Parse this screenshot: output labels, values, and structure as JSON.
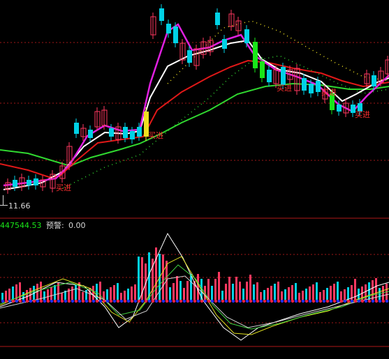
{
  "labels": {
    "price_low": "11.66",
    "indicator_value": "447544.53",
    "warn_label": "预警:",
    "warn_value": "0.00"
  },
  "signals": [
    "买进",
    "买进",
    "买进",
    "买进",
    "买进"
  ],
  "colors": {
    "up": "#ff3860",
    "down": "#00d2e6",
    "strong_down": "#19e619",
    "ma_fast": "#ffffff",
    "ma_purple": "#e020e0",
    "ma_red": "#e01818",
    "ma_green": "#30d830",
    "separator": "#b01818",
    "indicator_text": "#19e619",
    "signal_text": "#ff3030"
  }
}
